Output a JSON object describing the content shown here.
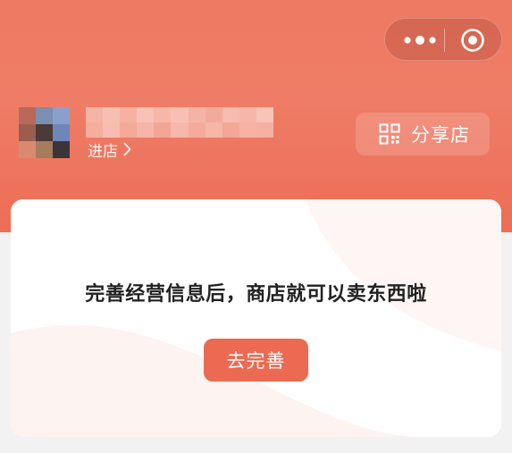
{
  "header": {
    "enter_store_label": "进店",
    "share_button_label": "分享店"
  },
  "card": {
    "message": "完善经营信息后，商店就可以卖东西啦",
    "cta_label": "去完善"
  },
  "colors": {
    "brand": "#ef7a62",
    "button": "#ec6a52"
  },
  "icons": {
    "more": "more-dots-icon",
    "close": "target-close-icon",
    "share": "qr-code-icon",
    "chevron": "chevron-right-icon"
  }
}
